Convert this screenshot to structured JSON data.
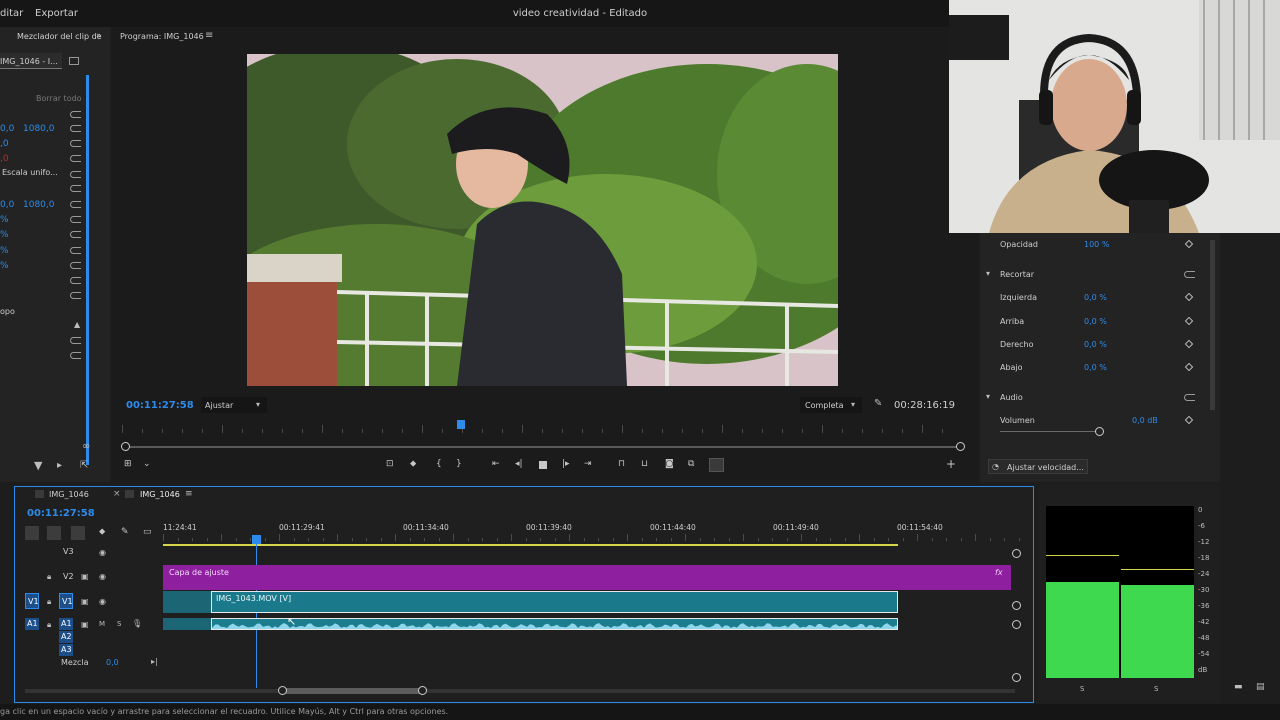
{
  "menu": {
    "tab_edit": "ditar",
    "tab_export": "Exportar",
    "title": "video creatividad - Editado"
  },
  "left_panel": {
    "header_label": "Mezclador del clip de",
    "clip_tab": "IMG_1046 - I...",
    "clear_all": "Borrar todo",
    "rows": [
      {
        "value": "0,0",
        "value2": "1080,0"
      },
      {
        "value": ",0",
        "value2": ""
      },
      {
        "value": ",0",
        "value2": ""
      },
      {
        "label": "Escala unifo..."
      },
      {
        "value": "0,0",
        "value2": "1080,0"
      },
      {
        "value": "%",
        "value2": ""
      },
      {
        "value": "%",
        "value2": ""
      },
      {
        "value": "%",
        "value2": ""
      },
      {
        "value": "%",
        "value2": ""
      },
      {
        "label": "opo"
      }
    ]
  },
  "program": {
    "title": "Programa: IMG_1046",
    "timecode_left": "00:11:27:58",
    "fit_select": "Ajustar",
    "quality_select": "Completa",
    "timecode_right": "00:28:16:19"
  },
  "webcam": {
    "description": "camera overlay"
  },
  "effects": {
    "opacity_label": "Opacidad",
    "opacity_value": "100 %",
    "crop_section": "Recortar",
    "crop_rows": [
      {
        "label": "Izquierda",
        "value": "0,0 %"
      },
      {
        "label": "Arriba",
        "value": "0,0 %"
      },
      {
        "label": "Derecho",
        "value": "0,0 %"
      },
      {
        "label": "Abajo",
        "value": "0,0 %"
      }
    ],
    "audio_section": "Audio",
    "volume_label": "Volumen",
    "volume_value": "0,0 dB",
    "speed_button": "Ajustar velocidad..."
  },
  "timeline": {
    "tab1": "IMG_1046",
    "tab2": "IMG_1046",
    "timecode": "00:11:27:58",
    "ruler_labels": [
      "11:24:41",
      "00:11:29:41",
      "00:11:34:40",
      "00:11:39:40",
      "00:11:44:40",
      "00:11:49:40",
      "00:11:54:40"
    ],
    "tracks": {
      "v3": "V3",
      "v2": "V2",
      "v1_src": "V1",
      "v1": "V1",
      "a1_src": "A1",
      "a1": "A1",
      "a2": "A2",
      "a3": "A3",
      "mix_label": "Mezcla",
      "mix_value": "0,0"
    },
    "adjustment_clip": "Capa de ajuste",
    "video_clip": "IMG_1043.MOV [V]",
    "fx_badge": "fx"
  },
  "meter": {
    "scale": [
      "0",
      "-6",
      "-12",
      "-18",
      "-24",
      "-30",
      "-36",
      "-42",
      "-48",
      "-54",
      "dB"
    ],
    "channel_l": "S",
    "channel_r": "S",
    "level_left": 0.56,
    "level_right": 0.54
  },
  "status": {
    "hint": "ga clic en un espacio vacío y arrastre para seleccionar el recuadro. Utilice Mayús, Alt y Ctrl para otras opciones."
  },
  "colors": {
    "accent": "#2d8ceb",
    "adjustment": "#8e1f9e",
    "video_clip": "#1a7a8c",
    "audio_clip": "#1c7d8f",
    "meter": "#3fd94f"
  }
}
